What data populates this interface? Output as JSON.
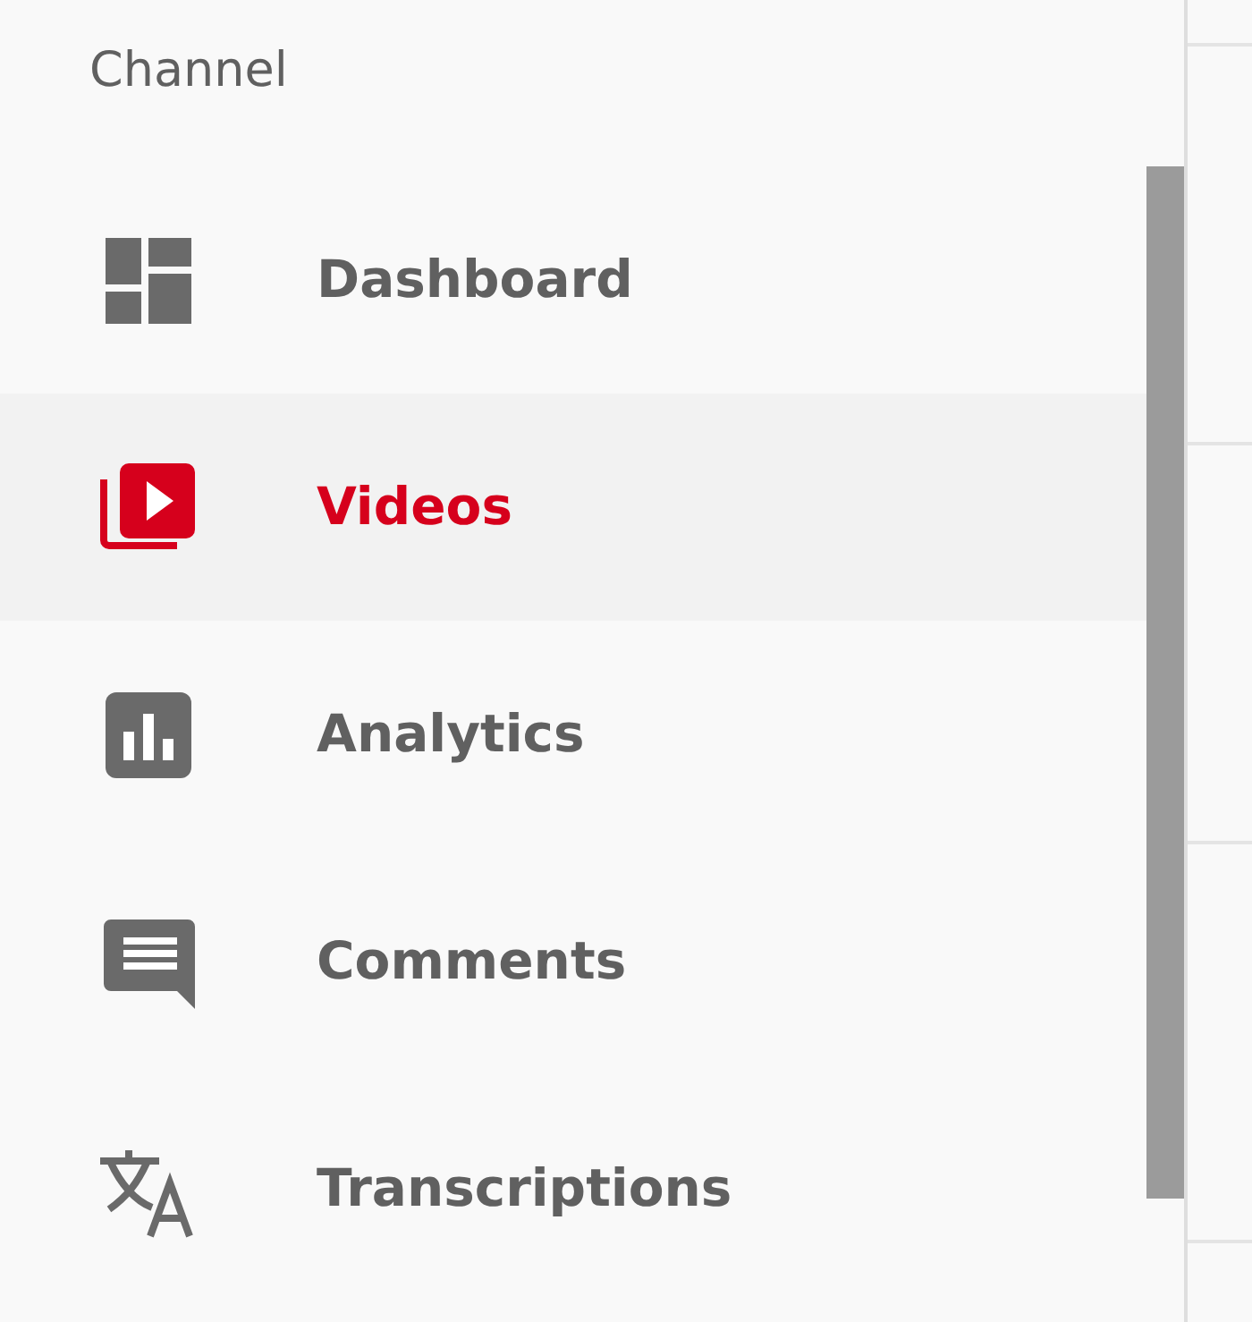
{
  "sidebar": {
    "heading": "Channel",
    "items": [
      {
        "label": "Dashboard",
        "selected": false
      },
      {
        "label": "Videos",
        "selected": true
      },
      {
        "label": "Analytics",
        "selected": false
      },
      {
        "label": "Comments",
        "selected": false
      },
      {
        "label": "Transcriptions",
        "selected": false
      }
    ]
  }
}
